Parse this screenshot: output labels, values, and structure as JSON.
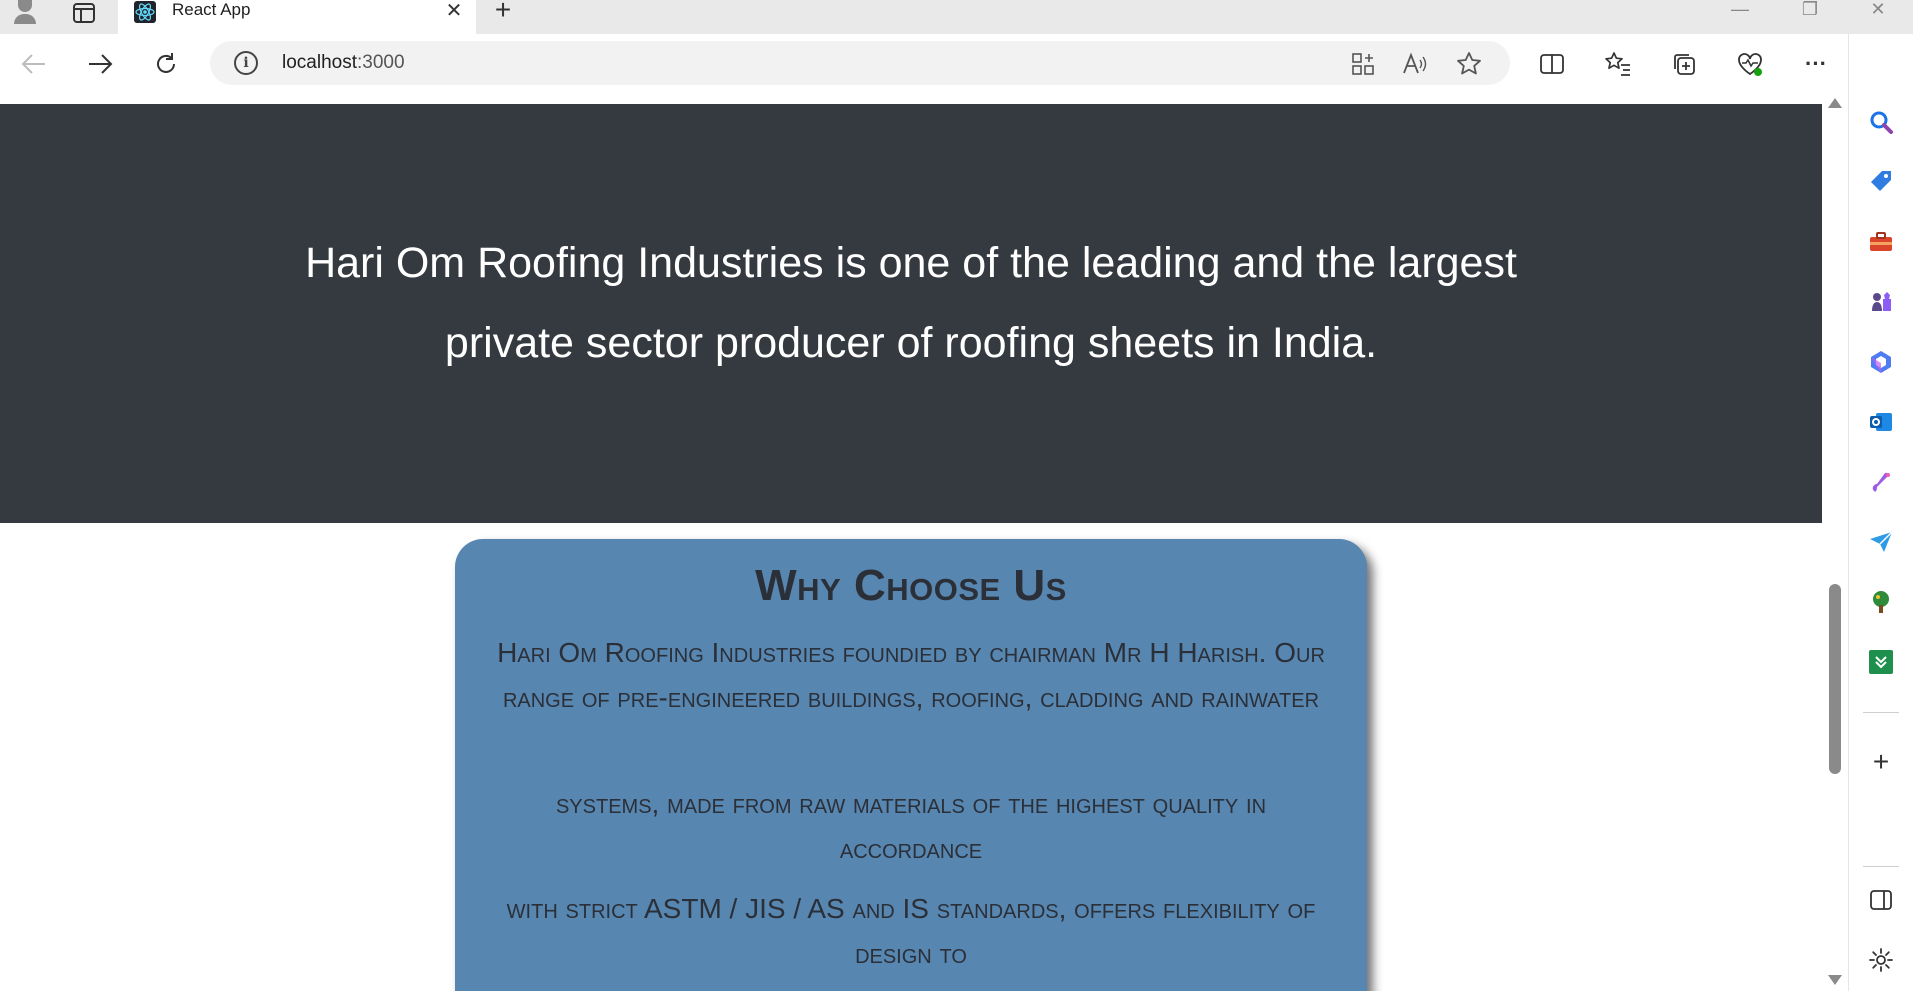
{
  "browser": {
    "tab_title": "React App",
    "tab_close_glyph": "✕",
    "new_tab_glyph": "+",
    "url_host": "localhost",
    "url_port": ":3000",
    "window_controls": [
      "—",
      "❐",
      "✕"
    ],
    "more_glyph": "···",
    "add_glyph": "+"
  },
  "hero": {
    "line1": "Hari Om Roofing Industries is one of the leading and the largest",
    "line2": "private sector producer of roofing sheets in India."
  },
  "why_card": {
    "title": "Why Choose Us",
    "paragraph1": "Hari Om Roofing Industries foundied by chairman Mr H Harish. Our range of pre-engineered buildings, roofing, cladding and rainwater",
    "paragraph2": "systems, made from raw materials of the highest quality in accordance",
    "paragraph3": "with strict ASTM / JIS / AS and IS standards, offers flexibility of design to"
  },
  "colors": {
    "hero_bg": "#343a40",
    "card_bg": "#5786b0",
    "card_text": "#2b2f38",
    "accent": "#0f6cbd"
  }
}
